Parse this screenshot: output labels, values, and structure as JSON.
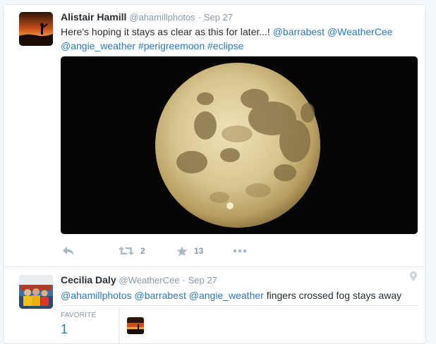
{
  "tweets": [
    {
      "author": {
        "fullname": "Alistair Hamill",
        "username": "@ahamillphotos"
      },
      "separator": "·",
      "timestamp": "Sep 27",
      "text_prefix": "Here's hoping it stays as clear as this for later...! ",
      "links": [
        "@barrabest",
        "@WeatherCee",
        "@angie_weather",
        "#perigreemoon",
        "#eclipse"
      ],
      "actions": {
        "retweet_count": "2",
        "favorite_count": "13"
      },
      "media_alt": "full moon photo"
    },
    {
      "author": {
        "fullname": "Cecilia Daly",
        "username": "@WeatherCee"
      },
      "separator": "·",
      "timestamp": "Sep 27",
      "links": [
        "@ahamillphotos",
        "@barrabest",
        "@angie_weather"
      ],
      "text_suffix": " fingers crossed fog stays away",
      "stats": {
        "favorite_label": "FAVORITE",
        "favorite_count": "1"
      }
    }
  ],
  "colors": {
    "link": "#2b7bb9",
    "muted": "#8899a6",
    "icon": "#aab8c2",
    "border": "#e1e8ed"
  },
  "icons": [
    "reply-icon",
    "retweet-icon",
    "favorite-icon",
    "more-icon",
    "location-pin-icon"
  ]
}
